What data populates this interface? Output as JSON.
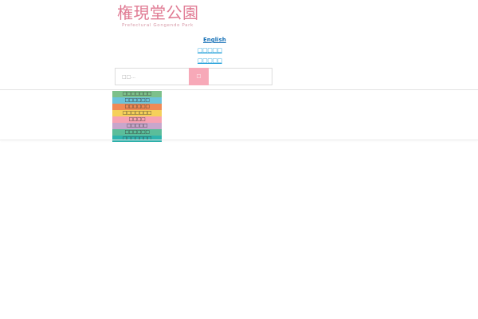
{
  "logo": {
    "title": "権現堂公園",
    "subtitle": "Prefectural Gongendo Park",
    "color": "#e07a93"
  },
  "languages": [
    {
      "label": "English"
    },
    {
      "label": "□□□□□"
    },
    {
      "label": "□□□□□"
    }
  ],
  "search": {
    "placeholder": "□□...",
    "button_label": "□",
    "button_color": "#f7a9b8"
  },
  "menu": {
    "items": [
      {
        "label": "□□□□□□□",
        "color": "#7cc08a"
      },
      {
        "label": "□□□□□□",
        "color": "#6cc3d9"
      },
      {
        "label": "□□□□□□",
        "color": "#f08a55"
      },
      {
        "label": "□□□□□□□",
        "color": "#f5d05a"
      },
      {
        "label": "□□□□",
        "color": "#f6a2b2"
      },
      {
        "label": "□□□□□",
        "color": "#c8a6cc"
      },
      {
        "label": "□□□□□□",
        "color": "#5bbd9a"
      },
      {
        "label": "□□□□□□□",
        "color": "#2eb3ad"
      }
    ]
  }
}
